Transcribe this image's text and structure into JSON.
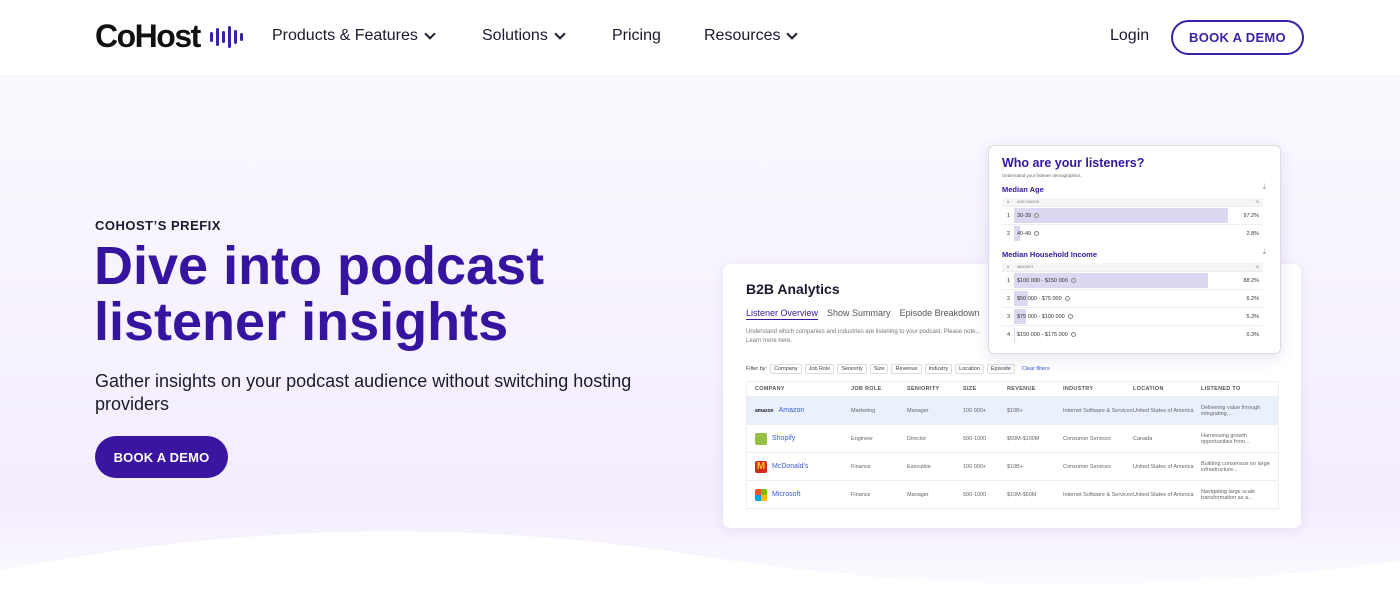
{
  "brand": {
    "name": "CoHost",
    "accent": "#3514a0"
  },
  "nav": {
    "items": [
      {
        "label": "Products & Features",
        "has_dropdown": true
      },
      {
        "label": "Solutions",
        "has_dropdown": true
      },
      {
        "label": "Pricing",
        "has_dropdown": false
      },
      {
        "label": "Resources",
        "has_dropdown": true
      }
    ],
    "login_label": "Login",
    "demo_label": "BOOK A DEMO"
  },
  "hero": {
    "eyebrow": "COHOST’S PREFIX",
    "headline": "Dive into podcast listener insights",
    "subhead": "Gather insights on your podcast audience without switching hosting providers",
    "cta_label": "BOOK A DEMO"
  },
  "b2b": {
    "title": "B2B Analytics",
    "tabs": [
      "Listener Overview",
      "Show Summary",
      "Episode Breakdown"
    ],
    "description": "Understand which companies and industries are listening to your podcast. Please note... Learn more here.",
    "filter_label": "Filter by:",
    "filters": [
      "Company",
      "Job Role",
      "Seniority",
      "Size",
      "Revenue",
      "Industry",
      "Location",
      "Episode"
    ],
    "clear_label": "Clear filters",
    "columns": [
      "COMPANY",
      "JOB ROLE",
      "SENIORITY",
      "SIZE",
      "REVENUE",
      "INDUSTRY",
      "LOCATION",
      "LISTENED TO"
    ],
    "rows": [
      {
        "company": "Amazon",
        "logo": "amazon-logo",
        "role": "Marketing",
        "seniority": "Manager",
        "size": "100 000+",
        "revenue": "$10B+",
        "industry": "Internet Software & Services",
        "location": "United States of America",
        "listened": "Delivering value through integrating..."
      },
      {
        "company": "Shopify",
        "logo": "shopify-logo",
        "role": "Engineer",
        "seniority": "Director",
        "size": "500-1000",
        "revenue": "$50M-$100M",
        "industry": "Consumer Services",
        "location": "Canada",
        "listened": "Harnessing growth opportunities from..."
      },
      {
        "company": "McDonald's",
        "logo": "mcdonalds-logo",
        "role": "Finance",
        "seniority": "Executive",
        "size": "100 000+",
        "revenue": "$10B+",
        "industry": "Consumer Services",
        "location": "United States of America",
        "listened": "Building consensus on large infrastructure..."
      },
      {
        "company": "Microsoft",
        "logo": "microsoft-logo",
        "role": "Finance",
        "seniority": "Manager",
        "size": "500-1000",
        "revenue": "$10M-$50M",
        "industry": "Internet Software & Services",
        "location": "United States of America",
        "listened": "Navigating large scale transformation as a..."
      }
    ]
  },
  "listeners": {
    "title": "Who are your listeners?",
    "subtitle": "Understand your listener demographics.",
    "age": {
      "label": "Median Age",
      "columns": [
        "#",
        "AGE RANGE",
        "%"
      ],
      "rows": [
        {
          "n": "1",
          "range": "30-39",
          "pct": "97.2%",
          "share": 97.2
        },
        {
          "n": "2",
          "range": "40-49",
          "pct": "2.8%",
          "share": 2.8
        }
      ]
    },
    "income": {
      "label": "Median Household Income",
      "columns": [
        "#",
        "AMOUNT",
        "%"
      ],
      "rows": [
        {
          "n": "1",
          "range": "$100 000 - $150 000",
          "pct": "88.2%",
          "share": 88.2
        },
        {
          "n": "2",
          "range": "$50 000 - $75 000",
          "pct": "6.2%",
          "share": 6.2
        },
        {
          "n": "3",
          "range": "$75 000 - $100 000",
          "pct": "5.3%",
          "share": 5.3
        },
        {
          "n": "4",
          "range": "$150 000 - $175 000",
          "pct": "0.3%",
          "share": 0.3
        }
      ]
    }
  }
}
